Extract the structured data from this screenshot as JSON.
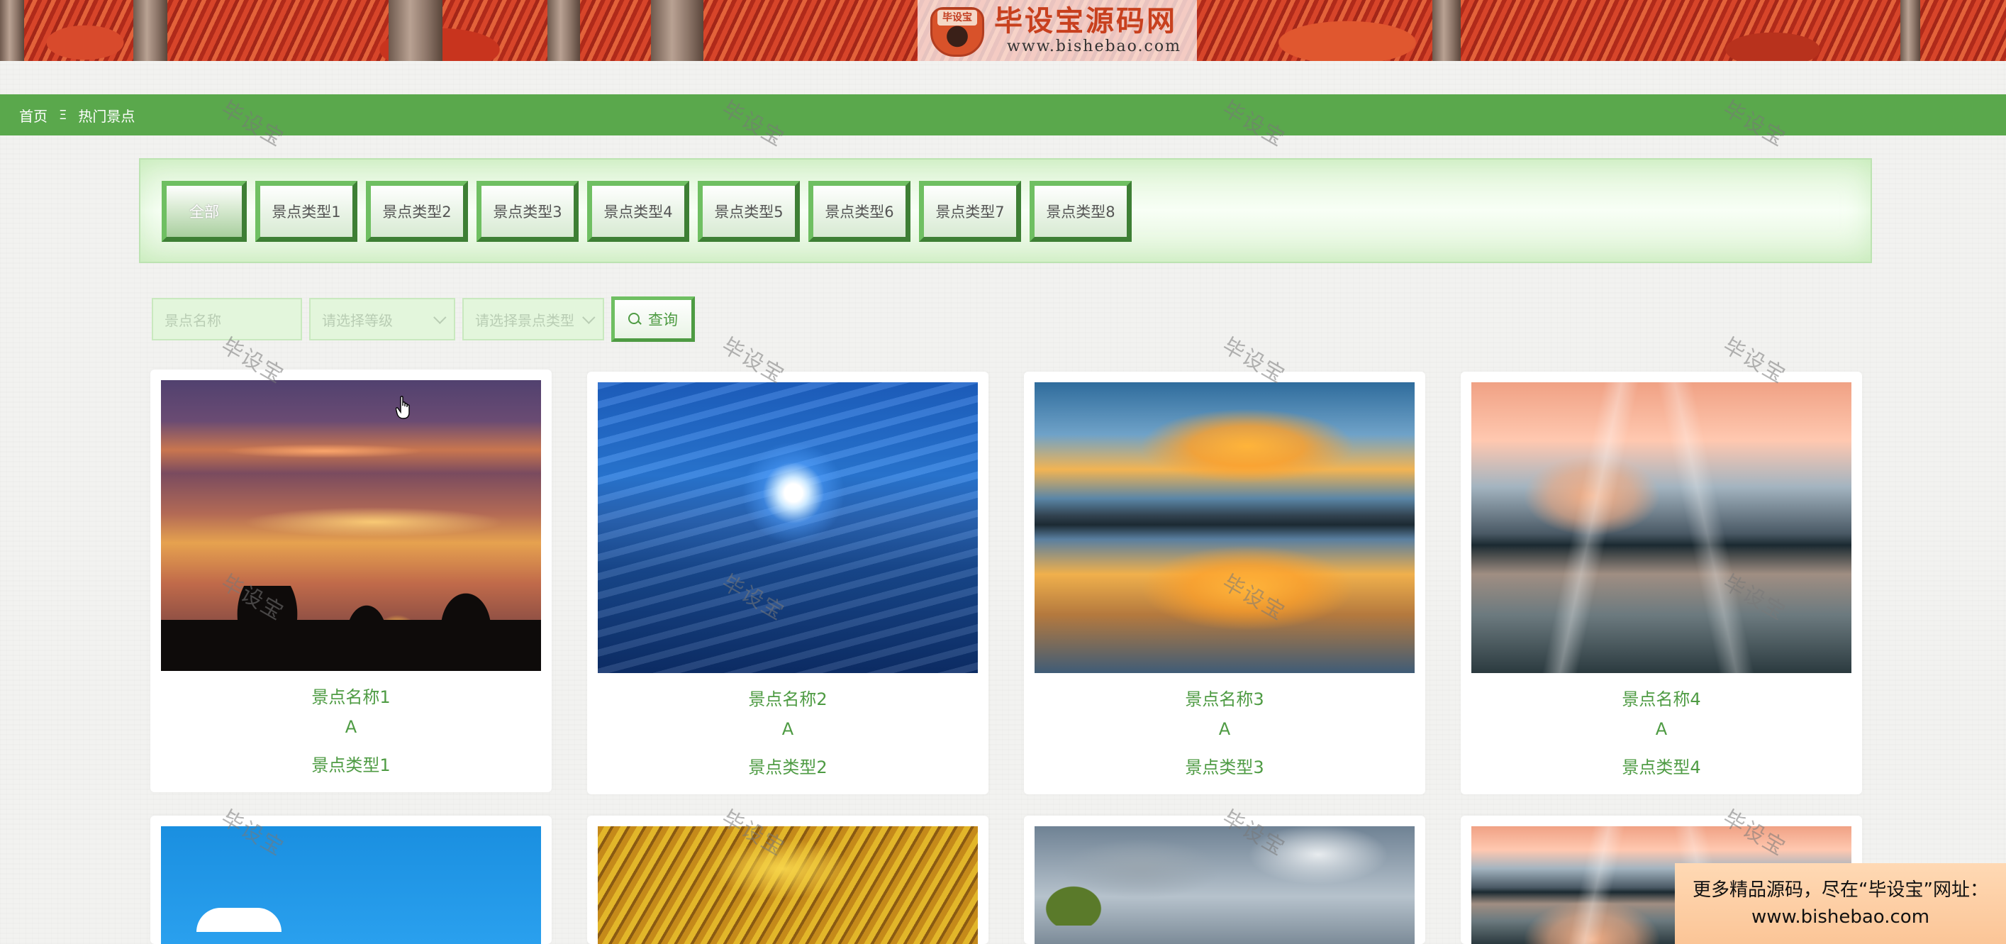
{
  "brand": {
    "logo_tag": "毕设宝",
    "title": "毕设宝源码网",
    "url": "www.bishebao.com"
  },
  "breadcrumb": {
    "home": "首页",
    "separator": "Ξ",
    "current": "热门景点"
  },
  "categories": [
    "全部",
    "景点类型1",
    "景点类型2",
    "景点类型3",
    "景点类型4",
    "景点类型5",
    "景点类型6",
    "景点类型7",
    "景点类型8"
  ],
  "search": {
    "name_placeholder": "景点名称",
    "level_placeholder": "请选择等级",
    "type_placeholder": "请选择景点类型",
    "button_label": "查询"
  },
  "cards": [
    {
      "name": "景点名称1",
      "level": "A",
      "type": "景点类型1"
    },
    {
      "name": "景点名称2",
      "level": "A",
      "type": "景点类型2"
    },
    {
      "name": "景点名称3",
      "level": "A",
      "type": "景点类型3"
    },
    {
      "name": "景点名称4",
      "level": "A",
      "type": "景点类型4"
    }
  ],
  "watermark": "毕设宝",
  "ad": {
    "line1": "更多精品源码，尽在“毕设宝”网址：",
    "line2": "www.bishebao.com"
  },
  "colors": {
    "primary_green": "#5aa84c",
    "text_green": "#4e9b43",
    "brand_red": "#c8401e"
  }
}
